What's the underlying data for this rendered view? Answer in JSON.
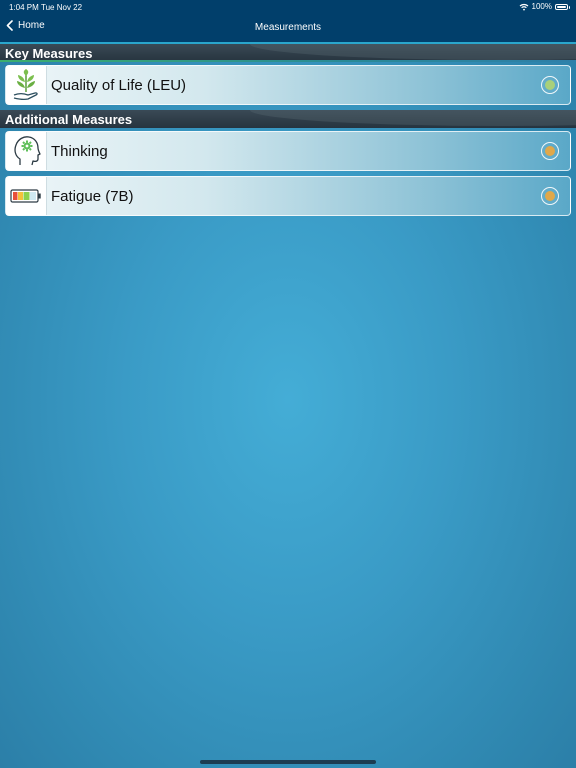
{
  "status": {
    "time": "1:04 PM",
    "date": "Tue Nov 22",
    "battery": "100%"
  },
  "nav": {
    "back_label": "Home",
    "title": "Measurements"
  },
  "sections": {
    "key": {
      "title": "Key Measures"
    },
    "additional": {
      "title": "Additional Measures"
    }
  },
  "items": [
    {
      "label": "Quality of Life (LEU)",
      "icon": "plant-hand-icon",
      "status_color": "#a8d07a"
    },
    {
      "label": "Thinking",
      "icon": "head-gear-icon",
      "status_color": "#e0a84a"
    },
    {
      "label": "Fatigue (7B)",
      "icon": "battery-level-icon",
      "status_color": "#e0a84a"
    }
  ],
  "colors": {
    "nav_bg": "#013f6b",
    "accent": "#2aa6cc"
  }
}
